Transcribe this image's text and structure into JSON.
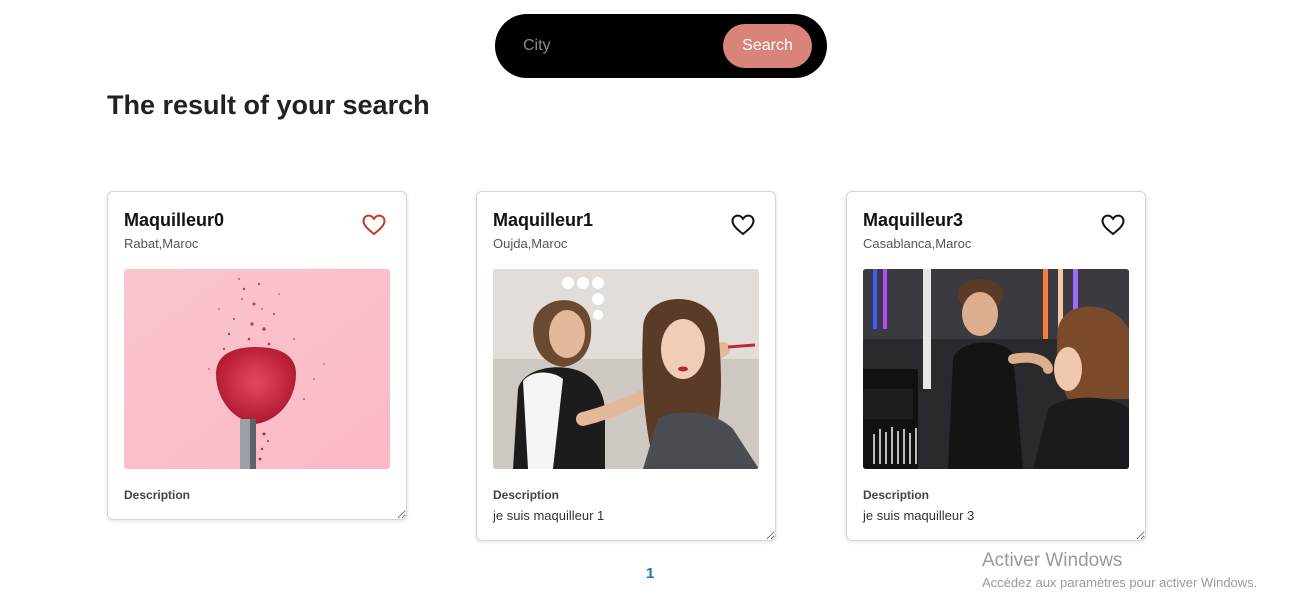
{
  "search": {
    "placeholder": "City",
    "value": "",
    "button_label": "Search"
  },
  "page_title": "The result of your search",
  "cards": [
    {
      "name": "Maquilleur0",
      "location": "Rabat,Maroc",
      "favorited": true,
      "image_icon": "makeup-brush-photo",
      "description_label": "Description",
      "description": ""
    },
    {
      "name": "Maquilleur1",
      "location": "Oujda,Maroc",
      "favorited": false,
      "image_icon": "makeup-artist-photo",
      "description_label": "Description",
      "description": "je suis maquilleur 1"
    },
    {
      "name": "Maquilleur3",
      "location": "Casablanca,Maroc",
      "favorited": false,
      "image_icon": "makeup-studio-photo",
      "description_label": "Description",
      "description": "je suis maquilleur 3"
    }
  ],
  "pagination": {
    "current_page": "1"
  },
  "windows_watermark": {
    "title": "Activer Windows",
    "subtitle": "Accédez aux paramètres pour activer Windows."
  },
  "colors": {
    "search_bar_bg": "#000000",
    "search_button": "#d9847a",
    "heart_active": "#c0392b",
    "pagination": "#1a73c9"
  }
}
